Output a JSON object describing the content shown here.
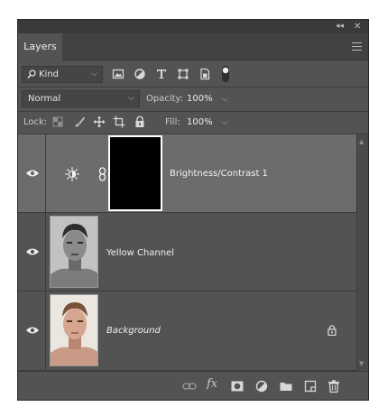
{
  "tabs": [
    {
      "label": "Layers"
    }
  ],
  "filter": {
    "kind_label": "Kind"
  },
  "blend": {
    "mode": "Normal",
    "opacity_label": "Opacity:",
    "opacity_value": "100%"
  },
  "lock": {
    "label": "Lock:",
    "fill_label": "Fill:",
    "fill_value": "100%"
  },
  "layers": [
    {
      "name": "Brightness/Contrast 1",
      "type": "adjustment",
      "selected": true,
      "visible": true
    },
    {
      "name": "Yellow Channel",
      "type": "pixel",
      "visible": true
    },
    {
      "name": "Background",
      "type": "background",
      "locked": true,
      "visible": true
    }
  ],
  "icons": {
    "titlebar": [
      "collapse-icon",
      "close-icon"
    ],
    "filter": [
      "image-filter-icon",
      "adjustment-filter-icon",
      "type-filter-icon",
      "shape-filter-icon",
      "smart-object-filter-icon",
      "filter-toggle-icon"
    ],
    "lock": [
      "lock-transparent-icon",
      "lock-image-icon",
      "lock-position-icon",
      "lock-artboard-icon",
      "lock-all-icon"
    ],
    "bottom": [
      "link-layers-icon",
      "fx-icon",
      "mask-icon",
      "new-adjustment-icon",
      "new-group-icon",
      "new-layer-icon",
      "delete-icon"
    ]
  },
  "colors": {
    "panel": "#535353",
    "selected_row": "#6c6c6c",
    "text": "#d6d6d6"
  }
}
